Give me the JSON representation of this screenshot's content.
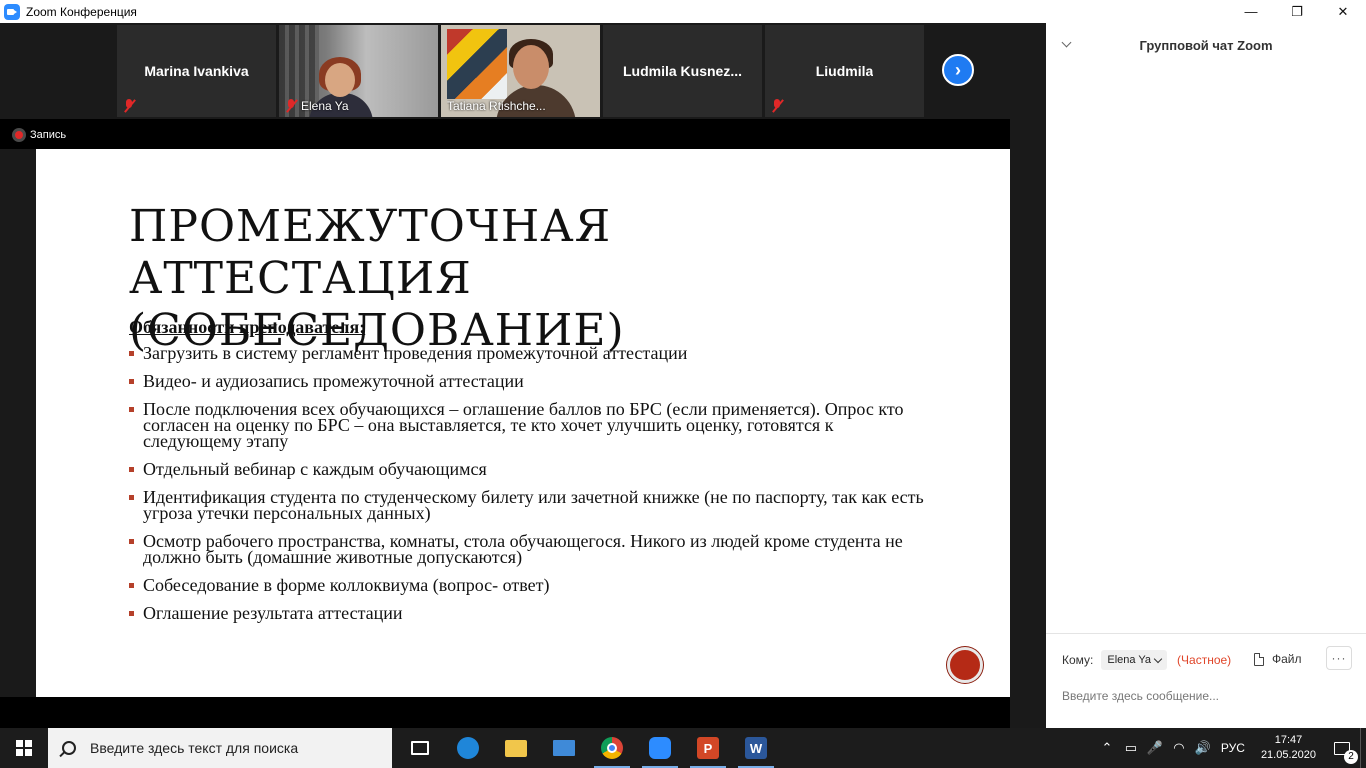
{
  "window": {
    "title": "Zoom Конференция",
    "minimize": "—",
    "maximize": "❐",
    "close": "✕"
  },
  "gallery": {
    "participants": [
      {
        "name": "Marina Ivankiva",
        "muted": true,
        "video": false
      },
      {
        "name": "Elena Ya",
        "muted": true,
        "video": true
      },
      {
        "name": "Tatiana Rtishche...",
        "muted": false,
        "video": true,
        "active_speaker": true
      },
      {
        "name": "Ludmila  Kusnez...",
        "muted": false,
        "video": false
      },
      {
        "name": "Liudmila",
        "muted": true,
        "video": false
      }
    ],
    "next_page_glyph": "›"
  },
  "recording": {
    "label": "Запись"
  },
  "slide": {
    "title_line1": "ПРОМЕЖУТОЧНАЯ АТТЕСТАЦИЯ",
    "title_line2": "(СОБЕСЕДОВАНИЕ)",
    "subtitle": "Обязанности преподавателя:",
    "bullets": [
      "Загрузить в систему регламент проведения промежуточной аттестации",
      "Видео- и аудиозапись промежуточной аттестации",
      "После подключения всех обучающихся – оглашение баллов по БРС (если применяется). Опрос кто согласен на оценку по БРС – она выставляется, те кто хочет улучшить оценку, готовятся к следующему этапу",
      "Отдельный вебинар с каждым обучающимся",
      "Идентификация студента по студенческому билету или зачетной книжке (не по паспорту, так как есть угроза утечки персональных данных)",
      "Осмотр рабочего пространства, комнаты, стола обучающегося. Никого из людей кроме студента не должно быть (домашние животные допускаются)",
      "Собеседование в форме коллоквиума (вопрос- ответ)",
      "Оглашение результата аттестации"
    ],
    "bullet_color": "#b5402a"
  },
  "chat": {
    "title": "Групповой чат Zoom",
    "to_label": "Кому:",
    "recipient": "Elena Ya",
    "private_label": "(Частное)",
    "file_label": "Файл",
    "more_label": "···",
    "input_placeholder": "Введите здесь сообщение...",
    "private_color": "#e0462a"
  },
  "taskbar": {
    "search_placeholder": "Введите здесь текст для поиска",
    "ppt_letter": "P",
    "word_letter": "W",
    "language": "РУС",
    "time": "17:47",
    "date": "21.05.2020",
    "notification_count": "2",
    "tray_up": "⌃",
    "tray_battery": "▭",
    "tray_mic": "🎤",
    "tray_wifi": "◠",
    "tray_volume": "🔊"
  }
}
